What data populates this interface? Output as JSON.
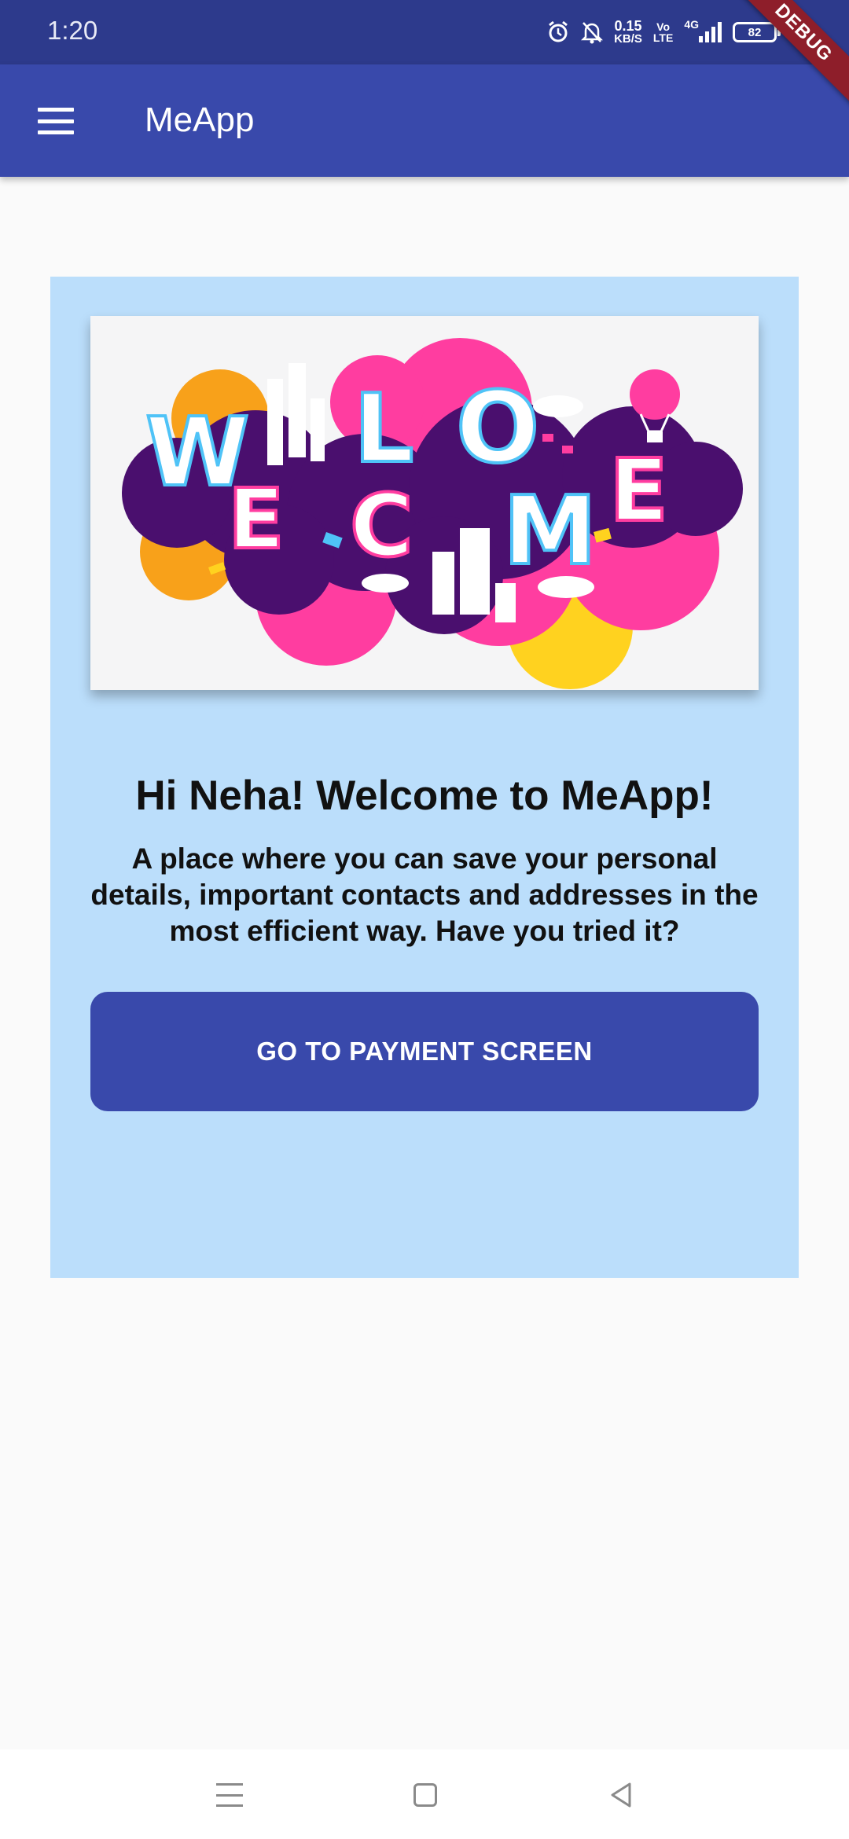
{
  "status_bar": {
    "time": "1:20",
    "net_speed_value": "0.15",
    "net_speed_unit": "KB/S",
    "volte_top": "Vo",
    "volte_bottom": "LTE",
    "network_type": "4G",
    "battery": "82",
    "icons": [
      "alarm-icon",
      "bell-off-icon",
      "network-speed-icon",
      "volte-icon",
      "signal-icon",
      "battery-icon",
      "charging-icon"
    ]
  },
  "debug_banner": "DEBUG",
  "app_bar": {
    "title": "MeApp",
    "menu_icon": "hamburger-menu-icon"
  },
  "card": {
    "image_text": "WELCOME",
    "greeting": "Hi Neha! Welcome to MeApp!",
    "description": "A place where you can save your personal details, important contacts and addresses in the most efficient way. Have you tried it?",
    "button_label": "GO TO PAYMENT SCREEN"
  },
  "nav_bar": {
    "icons": [
      "recent-apps-icon",
      "home-icon",
      "back-icon"
    ]
  },
  "colors": {
    "status_bar": "#2D3A8C",
    "app_bar": "#3949AB",
    "card_background": "#BBDEFB",
    "button": "#3949AB",
    "page_background": "#FAFAFA",
    "debug_ribbon": "#8E1E2A"
  }
}
